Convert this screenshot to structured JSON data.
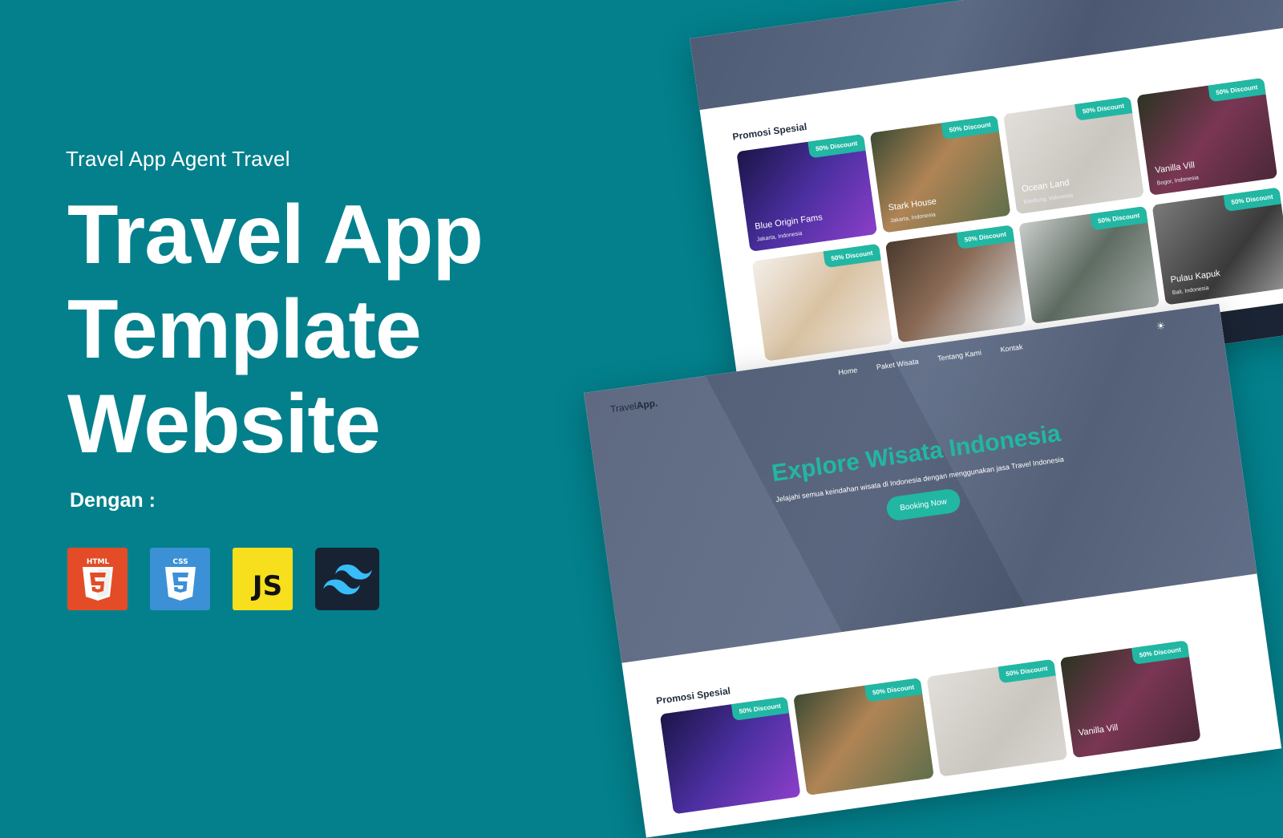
{
  "left": {
    "subtitle": "Travel App Agent Travel",
    "headline": [
      "Travel App",
      "Template",
      "Website"
    ],
    "with_label": "Dengan :",
    "tech_logos": [
      {
        "name": "html5-logo",
        "label": "HTML",
        "color": "#e34c26"
      },
      {
        "name": "css3-logo",
        "label": "CSS",
        "color": "#3c90d6"
      },
      {
        "name": "javascript-logo",
        "label": "JS",
        "color": "#f7df1e"
      },
      {
        "name": "tailwind-logo",
        "label": "",
        "color": "#172333"
      }
    ]
  },
  "site": {
    "brand": {
      "part1": "Travel",
      "part2": "App."
    },
    "nav": [
      "Home",
      "Paket Wisata",
      "Tentang Kami",
      "Kontak"
    ],
    "hero": {
      "title": "Explore Wisata Indonesia",
      "description": "Jelajahi semua keindahan wisata di Indonesia dengan menggunakan jasa Travel Indonesia",
      "button": "Booking Now"
    },
    "section_title": "Promosi Spesial",
    "badge": "50% Discount",
    "cards": [
      {
        "name": "Blue Origin Fams",
        "location": "Jakarta, Indonesia",
        "color": "#3b2b7a"
      },
      {
        "name": "Stark House",
        "location": "Jakarta, Indonesia",
        "color": "#8a6a48"
      },
      {
        "name": "Ocean Land",
        "location": "Bandung, Indonesia",
        "color": "#d4d1cc"
      },
      {
        "name": "Vanilla Vill",
        "location": "Bogor, Indonesia",
        "color": "#5b2c3d"
      },
      {
        "name": "",
        "location": "",
        "color": "#e7e1dc"
      },
      {
        "name": "",
        "location": "",
        "color": "#6b5444"
      },
      {
        "name": "",
        "location": "",
        "color": "#8c928f"
      },
      {
        "name": "Pulau Kapuk",
        "location": "Bali, Indonesia",
        "color": "#5c5c5c"
      }
    ]
  },
  "colors": {
    "background": "#03808c",
    "accent": "#21b7a3"
  }
}
